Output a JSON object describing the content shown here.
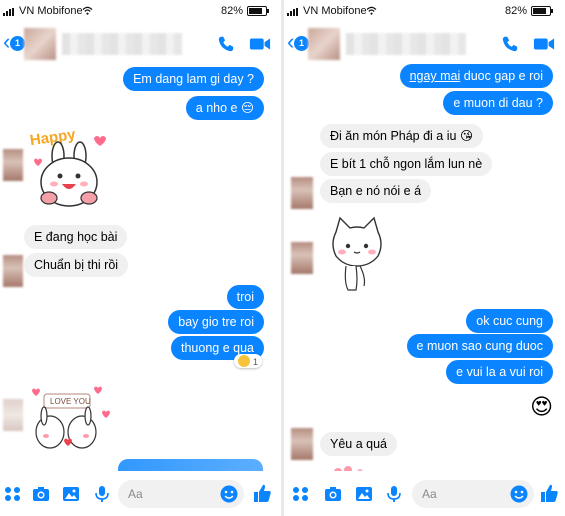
{
  "colors": {
    "messenger_blue": "#0a84ff",
    "incoming_bubble": "#f0f0f0"
  },
  "left": {
    "status": {
      "carrier": "VN Mobifone",
      "battery": "82%"
    },
    "header": {
      "unread_badge": "1",
      "back_icon": "chevron-left-icon",
      "call_icon": "phone-icon",
      "video_icon": "video-camera-icon"
    },
    "messages": [
      {
        "dir": "out",
        "text": "Em dang lam gi day ?"
      },
      {
        "dir": "out",
        "text": "a nho e 😔"
      },
      {
        "dir": "in",
        "type": "sticker",
        "name": "happy-bunny-sticker",
        "caption": "Happy"
      },
      {
        "dir": "in",
        "text": "E đang học bài"
      },
      {
        "dir": "in",
        "text": "Chuẩn bị thi rồi"
      },
      {
        "dir": "out",
        "text": "troi"
      },
      {
        "dir": "out",
        "text": "bay gio tre roi"
      },
      {
        "dir": "out",
        "text": "thuong e qua",
        "reaction_count": "1"
      },
      {
        "dir": "in",
        "type": "sticker",
        "name": "love-you-bunnies-sticker",
        "caption": "LOVE YOU"
      }
    ],
    "composer": {
      "placeholder": "Aa"
    }
  },
  "right": {
    "status": {
      "carrier": "VN Mobifone",
      "battery": "82%"
    },
    "header": {
      "unread_badge": "1",
      "back_icon": "chevron-left-icon",
      "call_icon": "phone-icon",
      "video_icon": "video-camera-icon"
    },
    "messages": [
      {
        "dir": "out",
        "text_link": "ngay mai",
        "text_rest": " duoc gap e roi"
      },
      {
        "dir": "out",
        "text": "e muon di dau ?"
      },
      {
        "dir": "in",
        "text": "Đi ăn món Pháp đi a iu 😘"
      },
      {
        "dir": "in",
        "text": "E bít 1 chỗ ngon lắm lun nè"
      },
      {
        "dir": "in",
        "text": "Bạn e nó nói e á"
      },
      {
        "dir": "in",
        "type": "sticker",
        "name": "white-cat-sticker"
      },
      {
        "dir": "out",
        "text": "ok cuc cung"
      },
      {
        "dir": "out",
        "text": "e muon sao cung duoc"
      },
      {
        "dir": "out",
        "text": "e vui la a vui roi"
      },
      {
        "dir": "out",
        "type": "emoji",
        "text": "😍"
      },
      {
        "dir": "in",
        "text": "Yêu a quá"
      }
    ],
    "composer": {
      "placeholder": "Aa"
    }
  }
}
